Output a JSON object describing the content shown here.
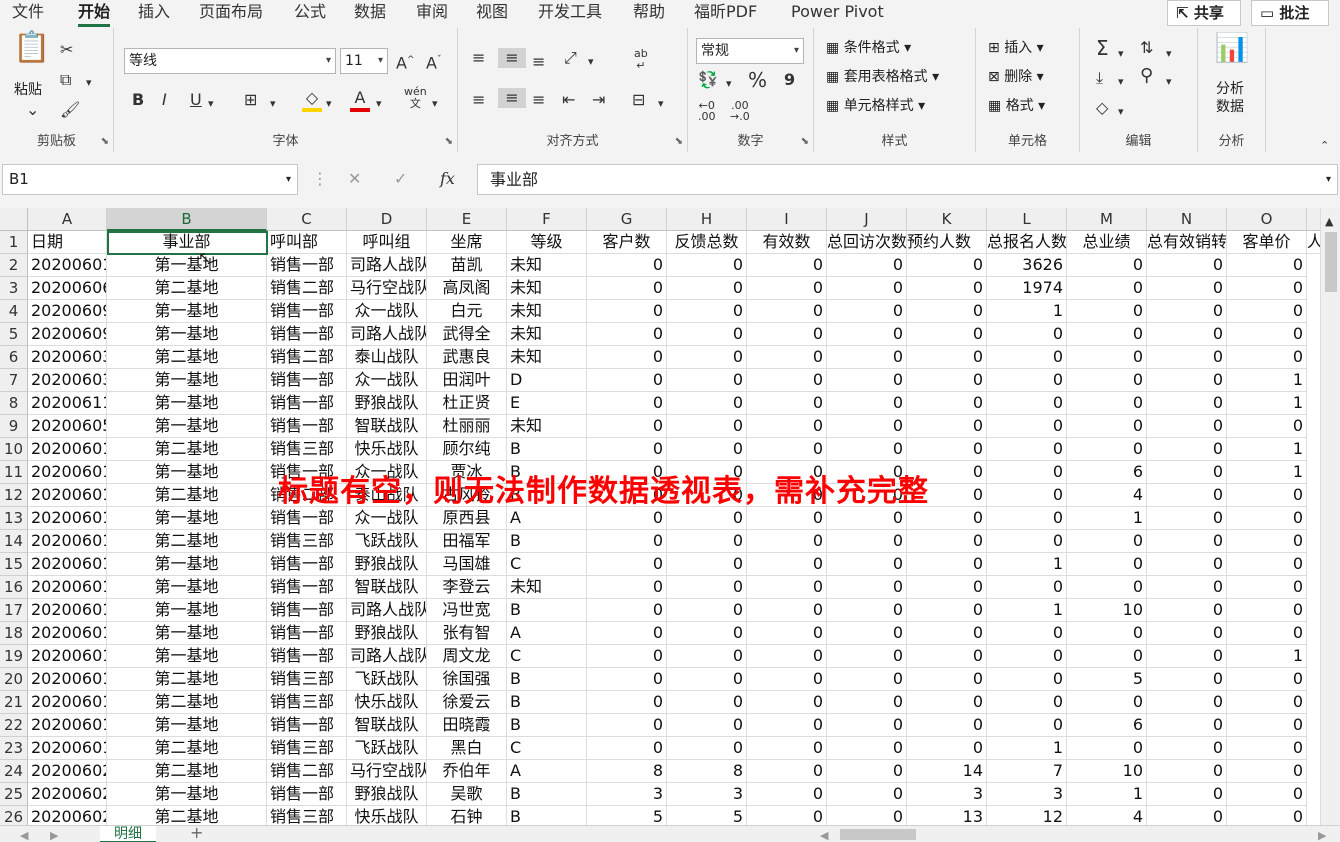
{
  "menu": {
    "tabs": [
      "文件",
      "开始",
      "插入",
      "页面布局",
      "公式",
      "数据",
      "审阅",
      "视图",
      "开发工具",
      "帮助",
      "福昕PDF",
      "Power Pivot"
    ],
    "active": "开始",
    "share": "共享",
    "comments": "批注"
  },
  "ribbon": {
    "clipboard": {
      "label": "剪贴板",
      "paste": "粘贴"
    },
    "font": {
      "label": "字体",
      "name": "等线",
      "size": "11",
      "bold": "B",
      "italic": "I",
      "underline": "U",
      "wen": "wén",
      "wen2": "文"
    },
    "alignment": {
      "label": "对齐方式"
    },
    "number": {
      "label": "数字",
      "format": "常规",
      "percent": "%",
      "comma": "9"
    },
    "styles": {
      "label": "样式",
      "conditional": "条件格式",
      "table": "套用表格格式",
      "cell": "单元格样式"
    },
    "cells": {
      "label": "单元格",
      "insert": "插入",
      "delete": "删除",
      "format": "格式"
    },
    "editing": {
      "label": "编辑"
    },
    "analysis": {
      "label": "分析",
      "button_line1": "分析",
      "button_line2": "数据"
    }
  },
  "formula_bar": {
    "name_box": "B1",
    "fx": "fx",
    "content": "事业部"
  },
  "sheet": {
    "columns": [
      "A",
      "B",
      "C",
      "D",
      "E",
      "F",
      "G",
      "H",
      "I",
      "J",
      "K",
      "L",
      "M",
      "N",
      "O"
    ],
    "headers": [
      "日期",
      "事业部",
      "呼叫部",
      "呼叫组",
      "坐席",
      "等级",
      "客户数",
      "反馈总数",
      "有效数",
      "总回访次数",
      "预约人数",
      "总报名人数",
      "总业绩",
      "总有效销转",
      "客单价",
      "人"
    ],
    "rows": [
      [
        "20200601",
        "第一基地",
        "销售一部",
        "司路人战队",
        "苗凯",
        "未知",
        "0",
        "0",
        "0",
        "0",
        "0",
        "3626",
        "0",
        "0",
        "0"
      ],
      [
        "20200606",
        "第二基地",
        "销售二部",
        "马行空战队",
        "高凤阁",
        "未知",
        "0",
        "0",
        "0",
        "0",
        "0",
        "1974",
        "0",
        "0",
        "0"
      ],
      [
        "20200609",
        "第一基地",
        "销售一部",
        "众一战队",
        "白元",
        "未知",
        "0",
        "0",
        "0",
        "0",
        "0",
        "1",
        "0",
        "0",
        "0"
      ],
      [
        "20200609",
        "第一基地",
        "销售一部",
        "司路人战队",
        "武得全",
        "未知",
        "0",
        "0",
        "0",
        "0",
        "0",
        "0",
        "0",
        "0",
        "0"
      ],
      [
        "20200603",
        "第二基地",
        "销售二部",
        "泰山战队",
        "武惠良",
        "未知",
        "0",
        "0",
        "0",
        "0",
        "0",
        "0",
        "0",
        "0",
        "0"
      ],
      [
        "20200603",
        "第一基地",
        "销售一部",
        "众一战队",
        "田润叶",
        "D",
        "0",
        "0",
        "0",
        "0",
        "0",
        "0",
        "0",
        "0",
        "1"
      ],
      [
        "20200611",
        "第一基地",
        "销售一部",
        "野狼战队",
        "杜正贤",
        "E",
        "0",
        "0",
        "0",
        "0",
        "0",
        "0",
        "0",
        "0",
        "1"
      ],
      [
        "20200605",
        "第一基地",
        "销售一部",
        "智联战队",
        "杜丽丽",
        "未知",
        "0",
        "0",
        "0",
        "0",
        "0",
        "0",
        "0",
        "0",
        "0"
      ],
      [
        "20200601",
        "第二基地",
        "销售三部",
        "快乐战队",
        "顾尔纯",
        "B",
        "0",
        "0",
        "0",
        "0",
        "0",
        "0",
        "0",
        "0",
        "1"
      ],
      [
        "20200601",
        "第一基地",
        "销售一部",
        "众一战队",
        "贾冰",
        "B",
        "0",
        "0",
        "0",
        "0",
        "0",
        "0",
        "6",
        "0",
        "1"
      ],
      [
        "20200601",
        "第二基地",
        "销售二部",
        "泰山战队",
        "古风铃",
        "B",
        "0",
        "0",
        "0",
        "0",
        "0",
        "0",
        "4",
        "0",
        "0"
      ],
      [
        "20200601",
        "第一基地",
        "销售一部",
        "众一战队",
        "原西县",
        "A",
        "0",
        "0",
        "0",
        "0",
        "0",
        "0",
        "1",
        "0",
        "0"
      ],
      [
        "20200601",
        "第二基地",
        "销售三部",
        "飞跃战队",
        "田福军",
        "B",
        "0",
        "0",
        "0",
        "0",
        "0",
        "0",
        "0",
        "0",
        "0"
      ],
      [
        "20200601",
        "第一基地",
        "销售一部",
        "野狼战队",
        "马国雄",
        "C",
        "0",
        "0",
        "0",
        "0",
        "0",
        "1",
        "0",
        "0",
        "0"
      ],
      [
        "20200601",
        "第一基地",
        "销售一部",
        "智联战队",
        "李登云",
        "未知",
        "0",
        "0",
        "0",
        "0",
        "0",
        "0",
        "0",
        "0",
        "0"
      ],
      [
        "20200601",
        "第一基地",
        "销售一部",
        "司路人战队",
        "冯世宽",
        "B",
        "0",
        "0",
        "0",
        "0",
        "0",
        "1",
        "10",
        "0",
        "0"
      ],
      [
        "20200601",
        "第一基地",
        "销售一部",
        "野狼战队",
        "张有智",
        "A",
        "0",
        "0",
        "0",
        "0",
        "0",
        "0",
        "0",
        "0",
        "0"
      ],
      [
        "20200601",
        "第一基地",
        "销售一部",
        "司路人战队",
        "周文龙",
        "C",
        "0",
        "0",
        "0",
        "0",
        "0",
        "0",
        "0",
        "0",
        "1"
      ],
      [
        "20200601",
        "第二基地",
        "销售三部",
        "飞跃战队",
        "徐国强",
        "B",
        "0",
        "0",
        "0",
        "0",
        "0",
        "0",
        "5",
        "0",
        "0"
      ],
      [
        "20200601",
        "第二基地",
        "销售三部",
        "快乐战队",
        "徐爱云",
        "B",
        "0",
        "0",
        "0",
        "0",
        "0",
        "0",
        "0",
        "0",
        "0"
      ],
      [
        "20200601",
        "第一基地",
        "销售一部",
        "智联战队",
        "田晓霞",
        "B",
        "0",
        "0",
        "0",
        "0",
        "0",
        "0",
        "6",
        "0",
        "0"
      ],
      [
        "20200601",
        "第二基地",
        "销售三部",
        "飞跃战队",
        "黑白",
        "C",
        "0",
        "0",
        "0",
        "0",
        "0",
        "1",
        "0",
        "0",
        "0"
      ],
      [
        "20200602",
        "第二基地",
        "销售二部",
        "马行空战队",
        "乔伯年",
        "A",
        "8",
        "8",
        "0",
        "0",
        "14",
        "7",
        "10",
        "0",
        "0"
      ],
      [
        "20200602",
        "第一基地",
        "销售一部",
        "野狼战队",
        "吴歌",
        "B",
        "3",
        "3",
        "0",
        "0",
        "3",
        "3",
        "1",
        "0",
        "0"
      ],
      [
        "20200602",
        "第二基地",
        "销售三部",
        "快乐战队",
        "石钟",
        "B",
        "5",
        "5",
        "0",
        "0",
        "13",
        "12",
        "4",
        "0",
        "0"
      ]
    ],
    "notice": "标题有空，则无法制作数据透视表，需补充完整",
    "sheet_tab": "明细",
    "add_sheet": "+"
  }
}
